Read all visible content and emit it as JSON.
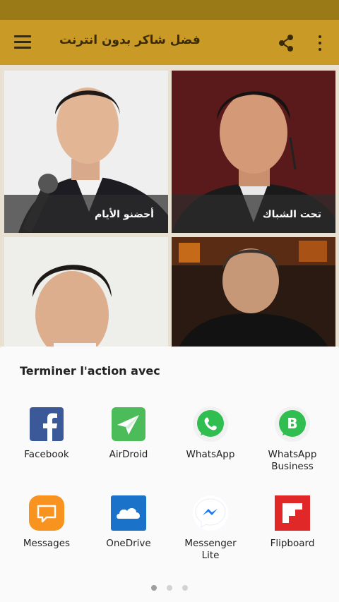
{
  "app_bar": {
    "title": "فضل شاكر بدون انترنت",
    "menu_icon": "hamburger-menu-icon",
    "share_icon": "share-icon",
    "more_icon": "more-vert-icon"
  },
  "songs": [
    {
      "title": "أحضنو الأيام"
    },
    {
      "title": "تحت الشباك"
    },
    {
      "title": ""
    },
    {
      "title": ""
    }
  ],
  "share_sheet": {
    "title": "Terminer l'action avec",
    "apps": [
      {
        "label": "Facebook",
        "icon": "facebook-icon"
      },
      {
        "label": "AirDroid",
        "icon": "airdroid-icon"
      },
      {
        "label": "WhatsApp",
        "icon": "whatsapp-icon"
      },
      {
        "label": "WhatsApp Business",
        "icon": "whatsapp-business-icon"
      },
      {
        "label": "Messages",
        "icon": "messages-icon"
      },
      {
        "label": "OneDrive",
        "icon": "onedrive-icon"
      },
      {
        "label": "Messenger Lite",
        "icon": "messenger-lite-icon"
      },
      {
        "label": "Flipboard",
        "icon": "flipboard-icon"
      }
    ],
    "pages": 3,
    "current_page": 1
  },
  "colors": {
    "status_bar": "#9a7a16",
    "app_bar": "#c99a26",
    "sheet": "#fafafa"
  }
}
